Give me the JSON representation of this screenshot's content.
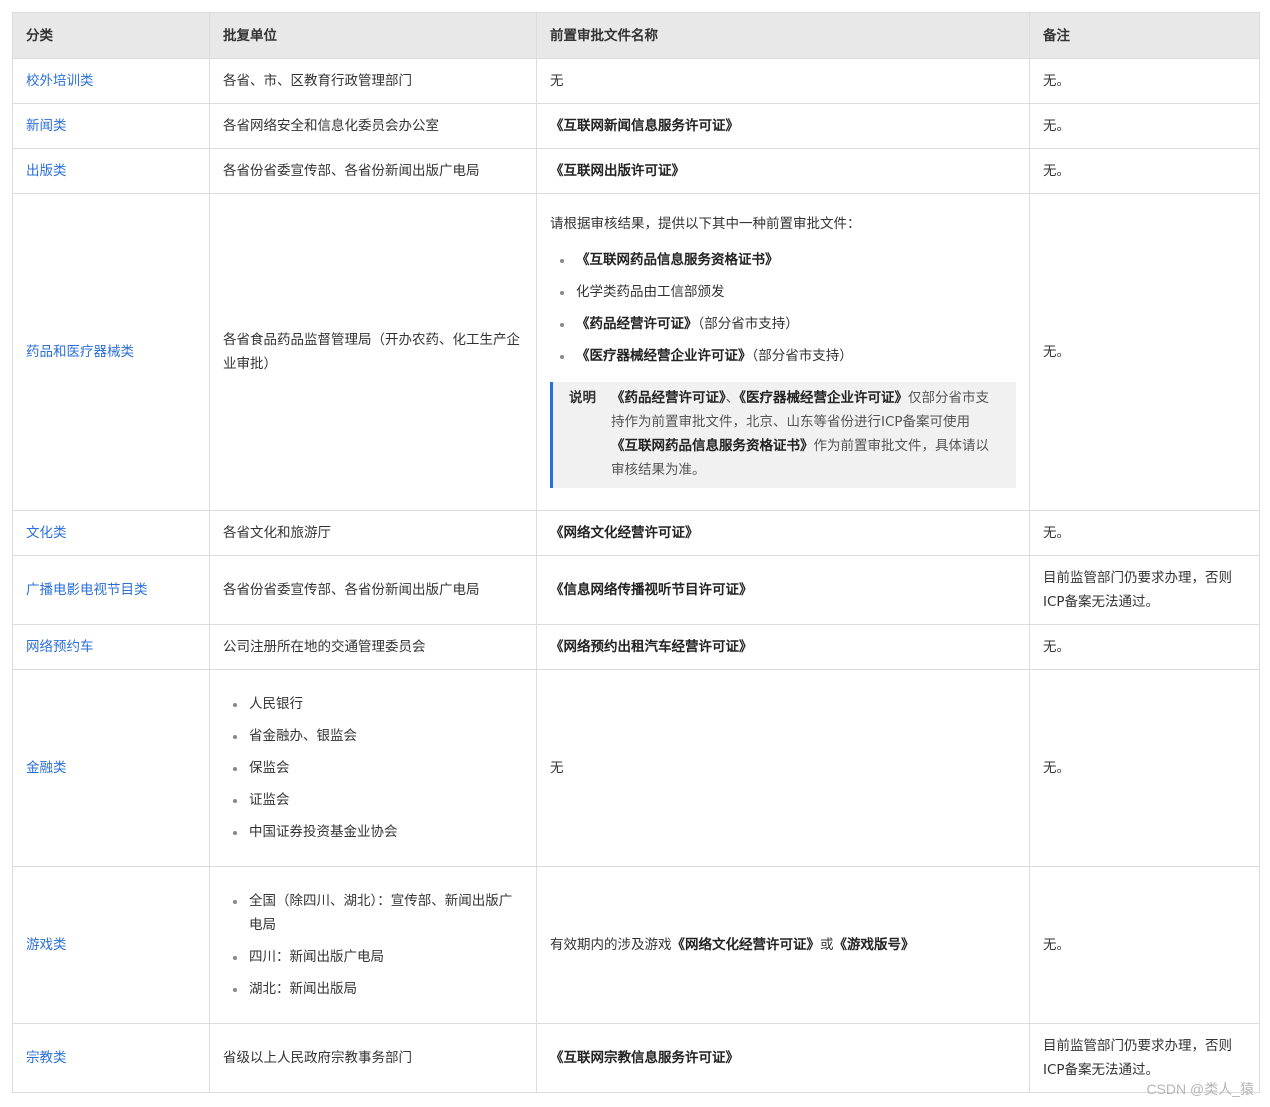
{
  "headers": [
    "分类",
    "批复单位",
    "前置审批文件名称",
    "备注"
  ],
  "rows": [
    {
      "category": "校外培训类",
      "unit": "各省、市、区教育行政管理部门",
      "doc": "无",
      "remark": "无。"
    },
    {
      "category": "新闻类",
      "unit": "各省网络安全和信息化委员会办公室",
      "doc": "《互联网新闻信息服务许可证》",
      "remark": "无。"
    },
    {
      "category": "出版类",
      "unit": "各省份省委宣传部、各省份新闻出版广电局",
      "doc": "《互联网出版许可证》",
      "remark": "无。"
    },
    {
      "category": "药品和医疗器械类",
      "unit": "各省食品药品监督管理局（开办农药、化工生产企业审批）",
      "doc_intro": "请根据审核结果，提供以下其中一种前置审批文件：",
      "doc_items": [
        {
          "bold": "《互联网药品信息服务资格证书》",
          "rest": ""
        },
        {
          "bold": "",
          "rest": "化学类药品由工信部颁发"
        },
        {
          "bold": "《药品经营许可证》",
          "rest": "（部分省市支持）"
        },
        {
          "bold": "《医疗器械经营企业许可证》",
          "rest": "（部分省市支持）"
        }
      ],
      "note": {
        "label": "说明",
        "bold1": "《药品经营许可证》",
        "sep": "、",
        "bold2": "《医疗器械经营企业许可证》",
        "text1": "仅部分省市支持作为前置审批文件，北京、山东等省份进行ICP备案可使用",
        "bold3": "《互联网药品信息服务资格证书》",
        "text2": "作为前置审批文件，具体请以审核结果为准。"
      },
      "remark": "无。"
    },
    {
      "category": "文化类",
      "unit": "各省文化和旅游厅",
      "doc": "《网络文化经营许可证》",
      "remark": "无。"
    },
    {
      "category": "广播电影电视节目类",
      "unit": "各省份省委宣传部、各省份新闻出版广电局",
      "doc": "《信息网络传播视听节目许可证》",
      "remark": "目前监管部门仍要求办理，否则ICP备案无法通过。"
    },
    {
      "category": "网络预约车",
      "unit": "公司注册所在地的交通管理委员会",
      "doc": "《网络预约出租汽车经营许可证》",
      "remark": "无。"
    },
    {
      "category": "金融类",
      "unit_items": [
        "人民银行",
        "省金融办、银监会",
        "保监会",
        "证监会",
        "中国证券投资基金业协会"
      ],
      "doc": "无",
      "remark": "无。"
    },
    {
      "category": "游戏类",
      "unit_items": [
        "全国（除四川、湖北）：宣传部、新闻出版广电局",
        "四川：新闻出版广电局",
        "湖北：新闻出版局"
      ],
      "doc_prefix": "有效期内的涉及游戏",
      "doc_bold1": "《网络文化经营许可证》",
      "doc_mid": "或",
      "doc_bold2": "《游戏版号》",
      "remark": "无。"
    },
    {
      "category": "宗教类",
      "unit": "省级以上人民政府宗教事务部门",
      "doc": "《互联网宗教信息服务许可证》",
      "remark": "目前监管部门仍要求办理，否则ICP备案无法通过。"
    }
  ],
  "watermark": "CSDN @类人_猿"
}
